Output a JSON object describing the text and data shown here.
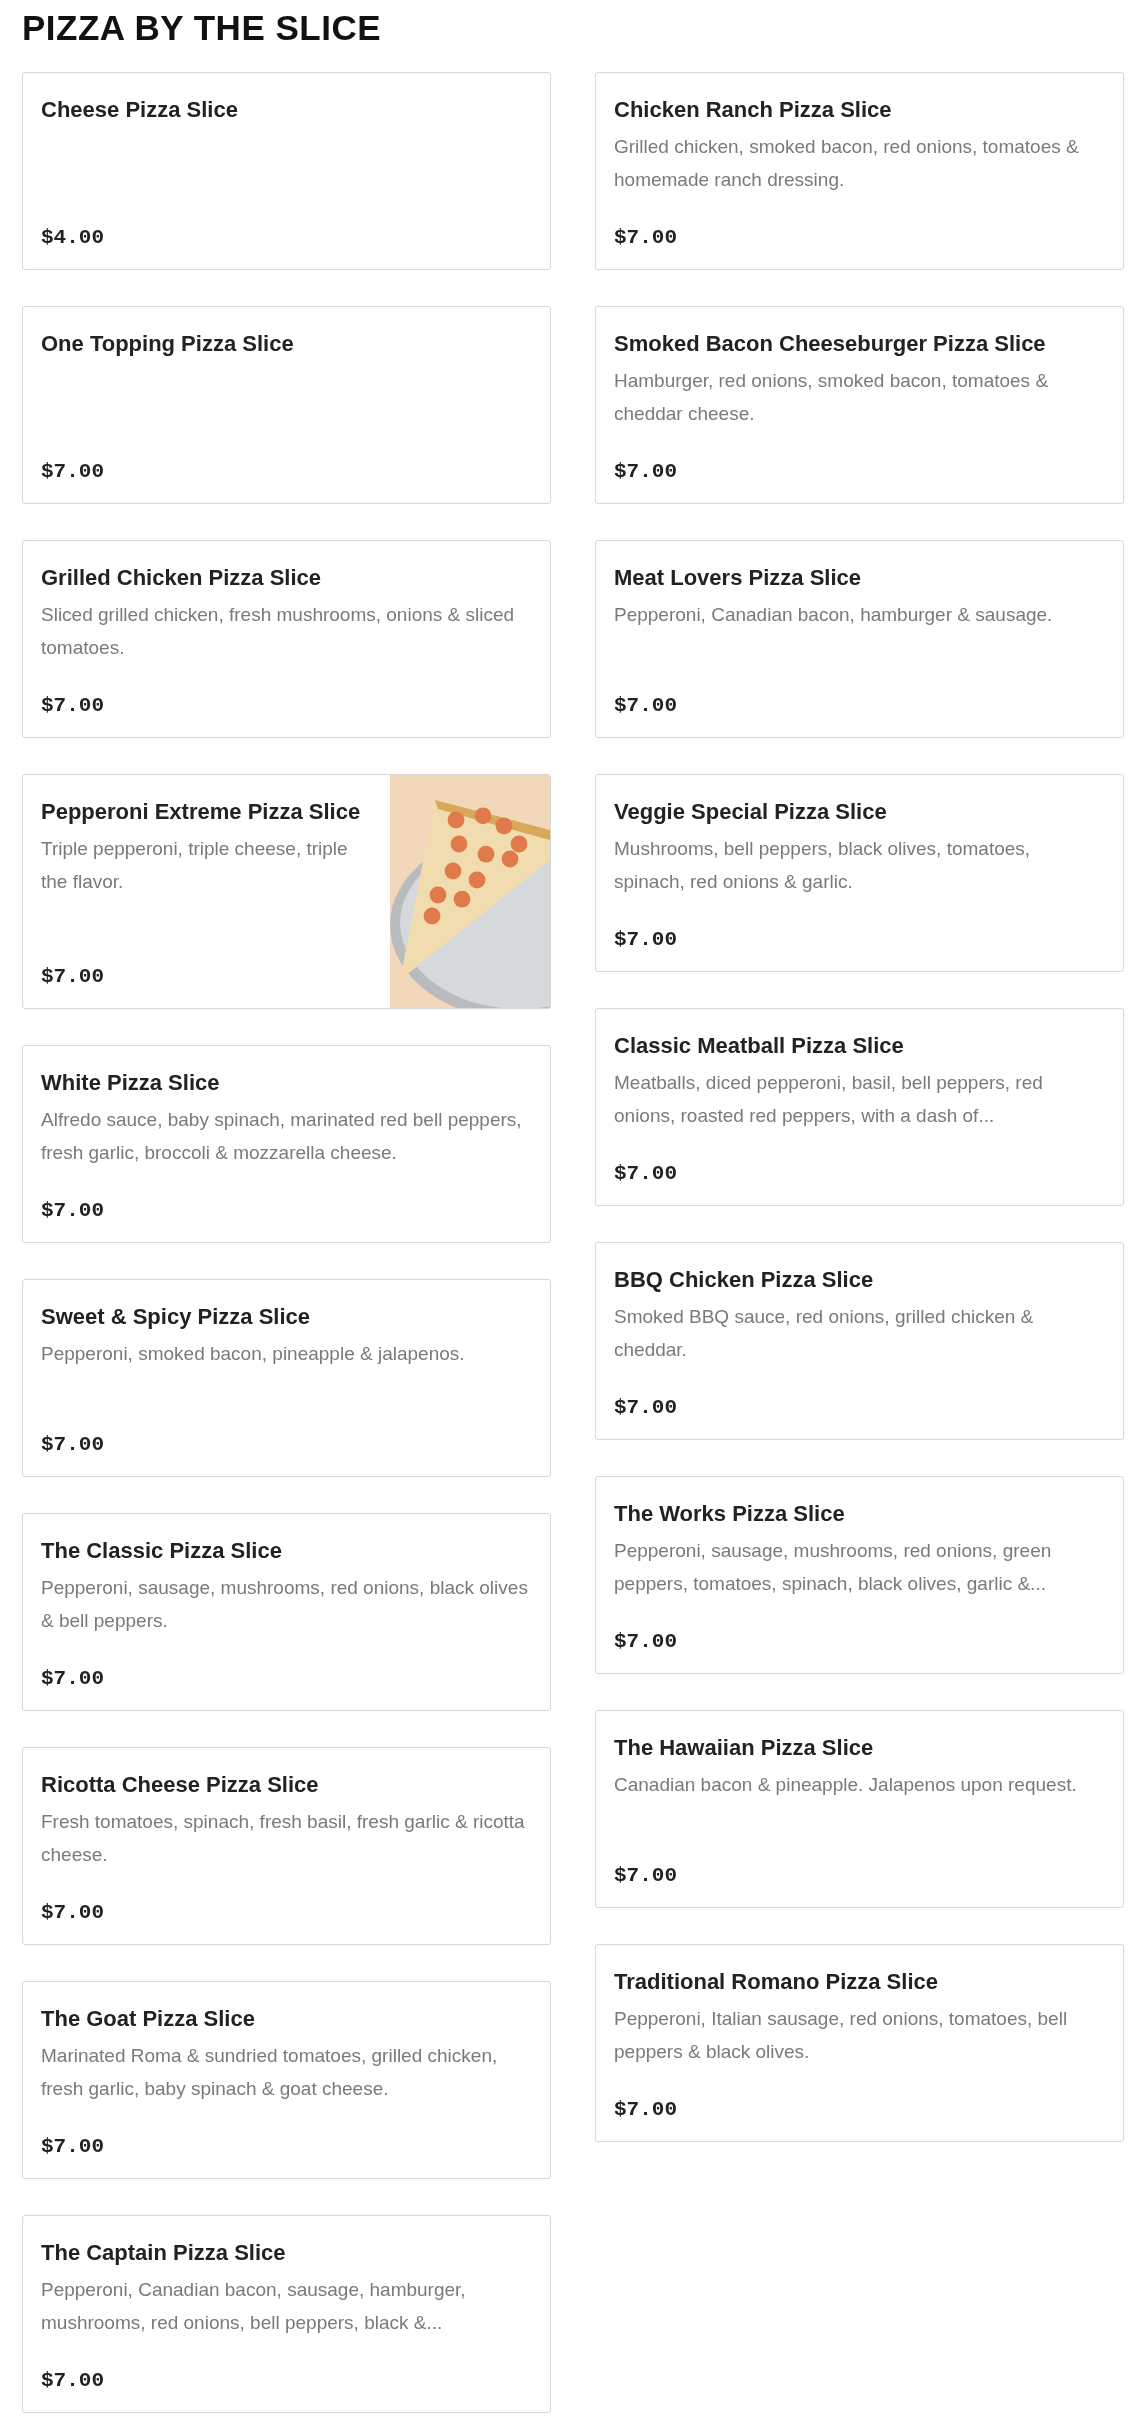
{
  "title": "PIZZA BY THE SLICE",
  "columns": [
    [
      {
        "name": "Cheese Pizza Slice",
        "price": "$4.00"
      },
      {
        "name": "One Topping Pizza Slice",
        "price": "$7.00"
      },
      {
        "name": "Grilled Chicken Pizza Slice",
        "description": "Sliced grilled chicken, fresh mushrooms, onions & sliced tomatoes.",
        "price": "$7.00"
      },
      {
        "name": "Pepperoni Extreme Pizza Slice",
        "description": "Triple pepperoni, triple cheese, triple the flavor.",
        "price": "$7.00"
      },
      {
        "name": "White Pizza Slice",
        "description": "Alfredo sauce, baby spinach, marinated red bell peppers, fresh garlic, broccoli & mozzarella cheese.",
        "price": "$7.00"
      },
      {
        "name": "Sweet & Spicy Pizza Slice",
        "description": "Pepperoni, smoked bacon, pineapple & jalapenos.",
        "price": "$7.00"
      },
      {
        "name": "The Classic Pizza Slice",
        "description": "Pepperoni, sausage, mushrooms, red onions, black olives & bell peppers.",
        "price": "$7.00"
      },
      {
        "name": "Ricotta Cheese Pizza Slice",
        "description": "Fresh tomatoes, spinach, fresh basil, fresh garlic & ricotta cheese.",
        "price": "$7.00"
      },
      {
        "name": "The Goat Pizza Slice",
        "description": "Marinated Roma & sundried tomatoes, grilled chicken, fresh garlic, baby spinach & goat cheese.",
        "price": "$7.00"
      },
      {
        "name": "The Captain Pizza Slice",
        "description": "Pepperoni, Canadian bacon, sausage, hamburger, mushrooms, red onions, bell peppers, black &...",
        "price": "$7.00"
      }
    ],
    [
      {
        "name": "Chicken Ranch Pizza Slice",
        "description": "Grilled chicken, smoked bacon, red onions, tomatoes & homemade ranch dressing.",
        "price": "$7.00"
      },
      {
        "name": "Smoked Bacon Cheeseburger Pizza Slice",
        "description": "Hamburger, red onions, smoked bacon, tomatoes & cheddar cheese.",
        "price": "$7.00"
      },
      {
        "name": "Meat Lovers Pizza Slice",
        "description": "Pepperoni, Canadian bacon, hamburger & sausage.",
        "price": "$7.00"
      },
      {
        "name": "Veggie Special Pizza Slice",
        "description": "Mushrooms, bell peppers, black olives, tomatoes, spinach, red onions & garlic.",
        "price": "$7.00"
      },
      {
        "name": "Classic Meatball Pizza Slice",
        "description": "Meatballs, diced pepperoni, basil, bell peppers, red onions, roasted red peppers, with a dash of...",
        "price": "$7.00"
      },
      {
        "name": "BBQ Chicken Pizza Slice",
        "description": "Smoked BBQ sauce, red onions, grilled chicken & cheddar.",
        "price": "$7.00"
      },
      {
        "name": "The Works Pizza Slice",
        "description": "Pepperoni, sausage, mushrooms, red onions, green peppers, tomatoes, spinach, black olives, garlic &...",
        "price": "$7.00"
      },
      {
        "name": "The Hawaiian Pizza Slice",
        "description": "Canadian bacon & pineapple. Jalapenos upon request.",
        "price": "$7.00"
      },
      {
        "name": "Traditional Romano Pizza Slice",
        "description": "Pepperoni, Italian sausage, red onions, tomatoes, bell peppers & black olives.",
        "price": "$7.00"
      }
    ]
  ]
}
